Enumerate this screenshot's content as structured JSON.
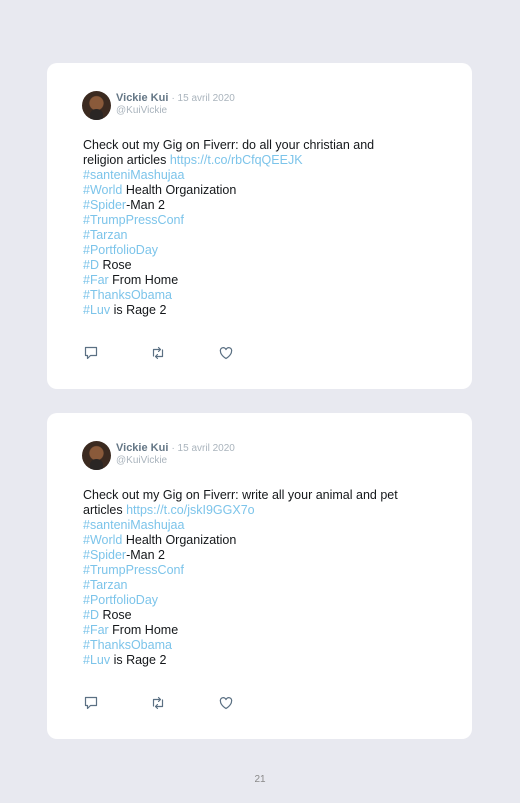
{
  "tweets": [
    {
      "author": "Vickie Kui",
      "date": "· 15 avril 2020",
      "handle": "@KuiVickie",
      "text_line1": "Check out my Gig on Fiverr: do all your christian and",
      "text_line2_prefix": "religion articles ",
      "link": "https://t.co/rbCfqQEEJK"
    },
    {
      "author": "Vickie Kui",
      "date": "· 15 avril 2020",
      "handle": "@KuiVickie",
      "text_line1": "Check out my Gig on Fiverr: write all your animal and pet",
      "text_line2_prefix": "articles ",
      "link": "https://t.co/jskI9GGX7o"
    }
  ],
  "hashtags": [
    {
      "tag": "#santeniMashujaa",
      "rest": ""
    },
    {
      "tag": "#World",
      "rest": " Health Organization"
    },
    {
      "tag": "#Spider",
      "rest": "-Man 2"
    },
    {
      "tag": "#TrumpPressConf",
      "rest": ""
    },
    {
      "tag": "#Tarzan",
      "rest": ""
    },
    {
      "tag": "#PortfolioDay",
      "rest": ""
    },
    {
      "tag": "#D",
      "rest": " Rose"
    },
    {
      "tag": "#Far",
      "rest": " From Home"
    },
    {
      "tag": "#ThanksObama",
      "rest": ""
    },
    {
      "tag": "#Luv",
      "rest": " is Rage 2"
    }
  ],
  "icons": [
    "reply-icon",
    "retweet-icon",
    "like-icon"
  ],
  "colors": {
    "link": "#7cc4ea",
    "icon": "#5b7083",
    "background": "#e8e9f0"
  },
  "page_number": "21"
}
